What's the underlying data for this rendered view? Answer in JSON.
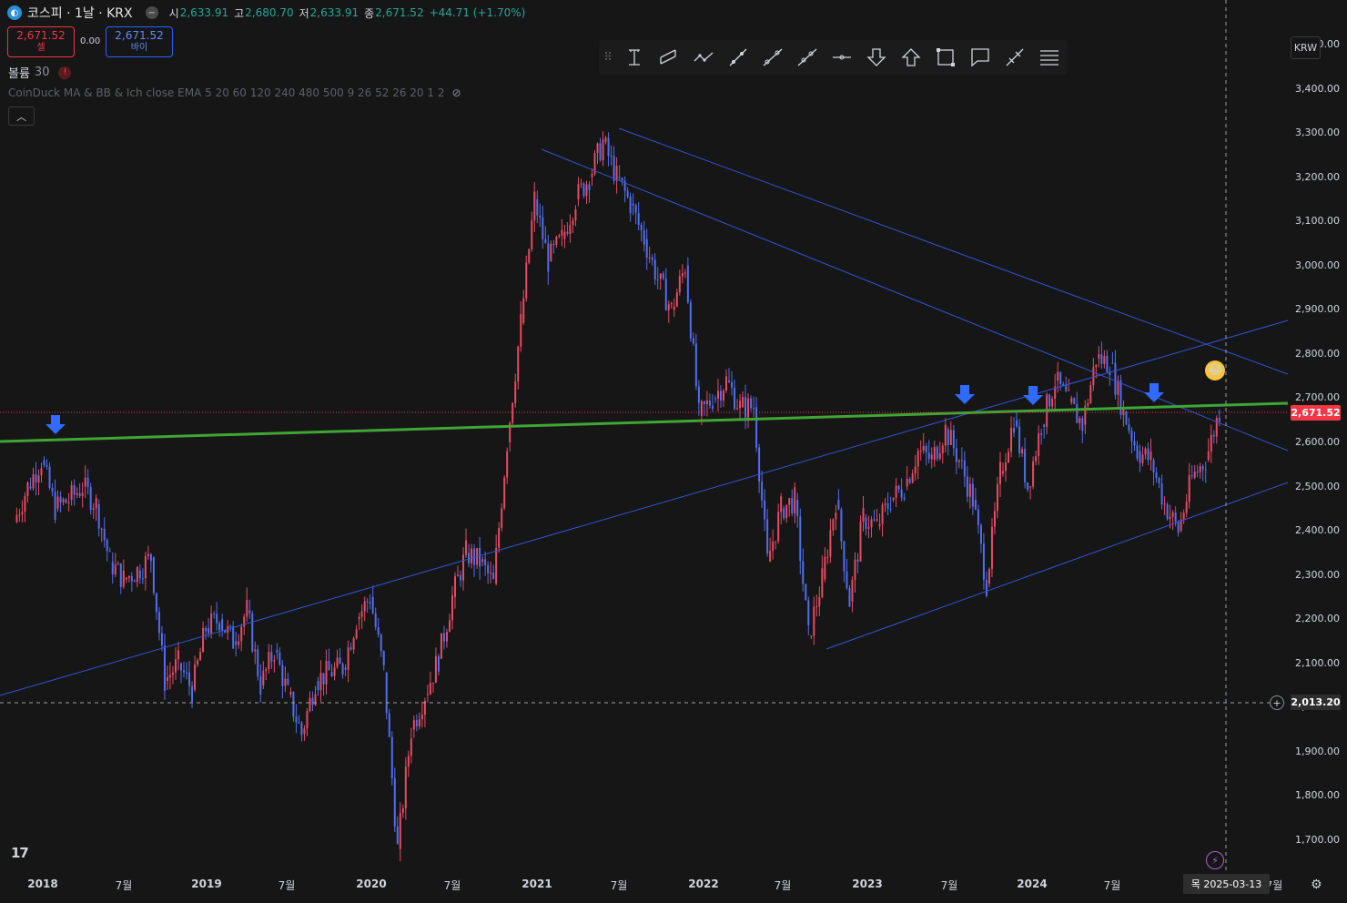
{
  "header": {
    "symbol": "코스피 · 1날 · KRX",
    "open_label": "시",
    "open": "2,633.91",
    "high_label": "고",
    "high": "2,680.70",
    "low_label": "저",
    "low": "2,633.91",
    "close_label": "종",
    "close": "2,671.52",
    "change": "+44.71 (+1.70%)"
  },
  "trade": {
    "sell_price": "2,671.52",
    "sell_label": "셀",
    "spread": "0.00",
    "buy_price": "2,671.52",
    "buy_label": "바이"
  },
  "volume": {
    "label": "볼륨",
    "value": "30"
  },
  "indicator": {
    "name": "CoinDuck MA & BB & Ich close EMA 5 20 60 120 240 480 500 9 26 52 26 20 1 2"
  },
  "currency": "KRW",
  "price_axis": {
    "labels": [
      "3,500.00",
      "3,400.00",
      "3,300.00",
      "3,200.00",
      "3,100.00",
      "3,000.00",
      "2,900.00",
      "2,800.00",
      "2,700.00",
      "2,600.00",
      "2,500.00",
      "2,400.00",
      "2,300.00",
      "2,200.00",
      "2,100.00",
      "2,000.00",
      "1,900.00",
      "1,800.00",
      "1,700.00"
    ],
    "last_price": "2,671.52",
    "crosshair_price": "2,013.20"
  },
  "time_axis": {
    "labels": [
      {
        "text": "2018",
        "year": true
      },
      {
        "text": "7월",
        "year": false
      },
      {
        "text": "2019",
        "year": true
      },
      {
        "text": "7월",
        "year": false
      },
      {
        "text": "2020",
        "year": true
      },
      {
        "text": "7월",
        "year": false
      },
      {
        "text": "2021",
        "year": true
      },
      {
        "text": "7월",
        "year": false
      },
      {
        "text": "2022",
        "year": true
      },
      {
        "text": "7월",
        "year": false
      },
      {
        "text": "2023",
        "year": true
      },
      {
        "text": "7월",
        "year": false
      },
      {
        "text": "2024",
        "year": true
      },
      {
        "text": "7월",
        "year": false
      },
      {
        "text": "7월",
        "year": false
      }
    ],
    "crosshair_date": "목 2025-03-13"
  },
  "toolbar": {
    "tools": [
      "text-tool-icon",
      "channel-tool-icon",
      "path-tool-icon",
      "ray-tool-icon",
      "trend-line-icon",
      "extended-line-icon",
      "horizontal-ray-icon",
      "arrow-down-icon",
      "arrow-up-icon",
      "rectangle-icon",
      "callout-icon",
      "measure-icon",
      "menu-lines-icon"
    ]
  },
  "colors": {
    "background": "#161616",
    "up_candle": "#e84a63",
    "down_candle": "#4f6ff0",
    "trendline": "#2f55d4",
    "support_line": "#3fa535",
    "price_tag": "#f23645",
    "arrow_marker": "#2f6bff"
  },
  "chart_data": {
    "type": "candlestick",
    "ylim": [
      1650,
      3550
    ],
    "close_path": [
      [
        "2017-11",
        2420
      ],
      [
        "2017-12",
        2500
      ],
      [
        "2018-01",
        2560
      ],
      [
        "2018-02",
        2450
      ],
      [
        "2018-03",
        2470
      ],
      [
        "2018-04",
        2500
      ],
      [
        "2018-05",
        2460
      ],
      [
        "2018-06",
        2330
      ],
      [
        "2018-07",
        2290
      ],
      [
        "2018-08",
        2310
      ],
      [
        "2018-09",
        2340
      ],
      [
        "2018-10",
        2060
      ],
      [
        "2018-11",
        2100
      ],
      [
        "2018-12",
        2040
      ],
      [
        "2019-01",
        2180
      ],
      [
        "2019-02",
        2200
      ],
      [
        "2019-03",
        2150
      ],
      [
        "2019-04",
        2220
      ],
      [
        "2019-05",
        2050
      ],
      [
        "2019-06",
        2130
      ],
      [
        "2019-07",
        2030
      ],
      [
        "2019-08",
        1940
      ],
      [
        "2019-09",
        2060
      ],
      [
        "2019-10",
        2080
      ],
      [
        "2019-11",
        2090
      ],
      [
        "2019-12",
        2200
      ],
      [
        "2020-01",
        2250
      ],
      [
        "2020-02",
        2080
      ],
      [
        "2020-03",
        1680
      ],
      [
        "2020-04",
        1950
      ],
      [
        "2020-05",
        2030
      ],
      [
        "2020-06",
        2110
      ],
      [
        "2020-07",
        2250
      ],
      [
        "2020-08",
        2350
      ],
      [
        "2020-09",
        2330
      ],
      [
        "2020-10",
        2280
      ],
      [
        "2020-11",
        2600
      ],
      [
        "2020-12",
        2870
      ],
      [
        "2021-01",
        3150
      ],
      [
        "2021-02",
        3010
      ],
      [
        "2021-03",
        3060
      ],
      [
        "2021-04",
        3150
      ],
      [
        "2021-05",
        3200
      ],
      [
        "2021-06",
        3280
      ],
      [
        "2021-07",
        3200
      ],
      [
        "2021-08",
        3140
      ],
      [
        "2021-09",
        3060
      ],
      [
        "2021-10",
        2970
      ],
      [
        "2021-11",
        2900
      ],
      [
        "2021-12",
        3000
      ],
      [
        "2022-01",
        2660
      ],
      [
        "2022-02",
        2700
      ],
      [
        "2022-03",
        2740
      ],
      [
        "2022-04",
        2680
      ],
      [
        "2022-05",
        2680
      ],
      [
        "2022-06",
        2330
      ],
      [
        "2022-07",
        2450
      ],
      [
        "2022-08",
        2470
      ],
      [
        "2022-09",
        2160
      ],
      [
        "2022-10",
        2290
      ],
      [
        "2022-11",
        2470
      ],
      [
        "2022-12",
        2240
      ],
      [
        "2023-01",
        2430
      ],
      [
        "2023-02",
        2410
      ],
      [
        "2023-03",
        2470
      ],
      [
        "2023-04",
        2500
      ],
      [
        "2023-05",
        2580
      ],
      [
        "2023-06",
        2560
      ],
      [
        "2023-07",
        2630
      ],
      [
        "2023-08",
        2560
      ],
      [
        "2023-09",
        2470
      ],
      [
        "2023-10",
        2280
      ],
      [
        "2023-11",
        2530
      ],
      [
        "2023-12",
        2650
      ],
      [
        "2024-01",
        2500
      ],
      [
        "2024-02",
        2640
      ],
      [
        "2024-03",
        2740
      ],
      [
        "2024-04",
        2690
      ],
      [
        "2024-05",
        2640
      ],
      [
        "2024-06",
        2790
      ],
      [
        "2024-07",
        2780
      ],
      [
        "2024-08",
        2670
      ],
      [
        "2024-09",
        2580
      ],
      [
        "2024-10",
        2560
      ],
      [
        "2024-11",
        2460
      ],
      [
        "2024-12",
        2400
      ],
      [
        "2025-01",
        2520
      ],
      [
        "2025-02",
        2560
      ],
      [
        "2025-03",
        2671.52
      ]
    ]
  }
}
